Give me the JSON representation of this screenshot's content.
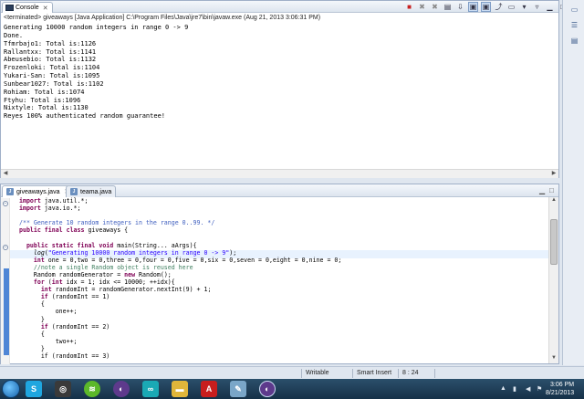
{
  "console": {
    "tab_label": "Console",
    "status_line": "<terminated> giveaways [Java Application] C:\\Program Files\\Java\\jre7\\bin\\javaw.exe (Aug 21, 2013 3:06:31 PM)",
    "output_lines": [
      "Generating 10000 random integers in range 0 -> 9",
      "Done.",
      "Tfmrbajo1: Total is:1126",
      "Rallantxx: Total is:1141",
      "Abeusebio: Total is:1132",
      "Frozenloki: Total is:1104",
      "Yukari-San: Total is:1095",
      "Sunbear1027: Total is:1102",
      "Rohiam: Total is:1074",
      "Ftyhu: Total is:1096",
      "Nixtyle: Total is:1130",
      "Reyes 100% authenticated random guarantee!"
    ]
  },
  "editor": {
    "tabs": [
      {
        "label": "giveaways.java",
        "active": true
      },
      {
        "label": "teama.java",
        "active": false
      }
    ],
    "code": {
      "l1_kw": "import",
      "l1_rest": " java.util.*;",
      "l2_kw": "import",
      "l2_rest": " java.io.*;",
      "l4_doc": "/** Generate 10 random integers in the range 0..99. */",
      "l5_kw": "public final class",
      "l5_rest": " giveaways {",
      "l7_kw": "public static final void",
      "l7_rest": " main(String... aArgs){",
      "l8_call": "log",
      "l8_open": "(",
      "l8_str": "\"Generating 10000 random integers in range 0 -> 9\"",
      "l8_close": ");",
      "l9_kw": "int",
      "l9_rest": " one = 0,two = 0,three = 0,four = 0,five = 0,six = 0,seven = 0,eight = 0,nine = 0;",
      "l10_cm": "//note a single Random object is reused here",
      "l11_a": "Random randomGenerator = ",
      "l11_kw": "new",
      "l11_b": " Random();",
      "l12_kw": "for",
      "l12_a": " (",
      "l12_kw2": "int",
      "l12_b": " idx = 1; idx <= 10000; ++idx){",
      "l13_kw": "int",
      "l13_rest": " randomInt = randomGenerator.nextInt(9) + 1;",
      "l14_kw": "if",
      "l14_rest": " (randomInt == 1)",
      "l15": "{",
      "l16": "one++;",
      "l17": "}",
      "l18_kw": "if",
      "l18_rest": " (randomInt == 2)",
      "l19": "{",
      "l20": "two++;",
      "l21": "}",
      "l22_partial": "if (randomInt == 3)"
    }
  },
  "statusbar": {
    "writable": "Writable",
    "insert_mode": "Smart Insert",
    "position": "8 : 24"
  },
  "taskbar": {
    "time": "3:06 PM",
    "date": "8/21/2013"
  }
}
